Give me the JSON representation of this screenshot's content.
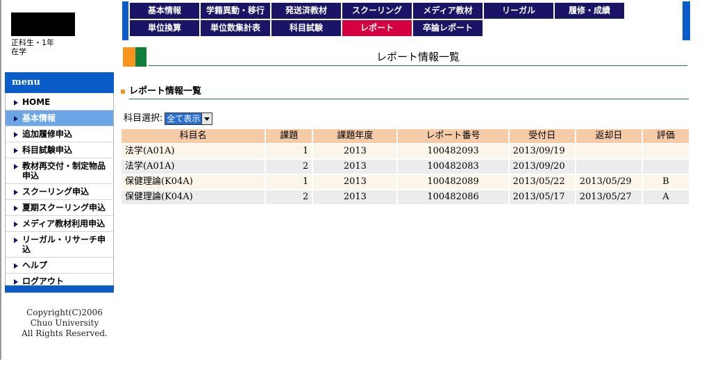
{
  "user": {
    "status_line1": "正科生・1年",
    "status_line2": "在学"
  },
  "nav": {
    "row1": [
      "基本情報",
      "学籍異動・移行",
      "発送済教材",
      "スクーリング",
      "メディア教材",
      "リーガル",
      "履修・成績"
    ],
    "row2": [
      "単位換算",
      "単位数集計表",
      "科目試験",
      "レポート",
      "卒論レポート"
    ],
    "active": "レポート"
  },
  "page_title": "レポート情報一覧",
  "sidebar": {
    "header": "menu",
    "items": [
      "HOME",
      "基本情報",
      "追加履修申込",
      "科目試験申込",
      "教材再交付・制定物品申込",
      "スクーリング申込",
      "夏期スクーリング申込",
      "メディア教材利用申込",
      "リーガル・リサーチ申込",
      "ヘルプ",
      "ログアウト"
    ],
    "active": "基本情報"
  },
  "copyright": {
    "line1": "Copyright(C)2006",
    "line2": "Chuo University",
    "line3": "All Rights Reserved."
  },
  "section_title": "レポート情報一覧",
  "filter": {
    "label": "科目選択:",
    "selected": "全て表示"
  },
  "table": {
    "headers": [
      "科目名",
      "課題",
      "課題年度",
      "レポート番号",
      "受付日",
      "返却日",
      "評価"
    ],
    "rows": [
      [
        "法学(A01A)",
        "1",
        "2013",
        "100482093",
        "2013/09/19",
        "",
        ""
      ],
      [
        "法学(A01A)",
        "2",
        "2013",
        "100482083",
        "2013/09/20",
        "",
        ""
      ],
      [
        "保健理論(K04A)",
        "1",
        "2013",
        "100482089",
        "2013/05/22",
        "2013/05/29",
        "B"
      ],
      [
        "保健理論(K04A)",
        "2",
        "2013",
        "100482086",
        "2013/05/17",
        "2013/05/27",
        "A"
      ]
    ]
  },
  "colors": {
    "nav_bg": "#1a1466",
    "nav_active": "#d4003f",
    "accent_blue": "#0a5cc9",
    "header_orange": "#f5cba8",
    "title_orange": "#f7941d",
    "title_green": "#12803a"
  }
}
